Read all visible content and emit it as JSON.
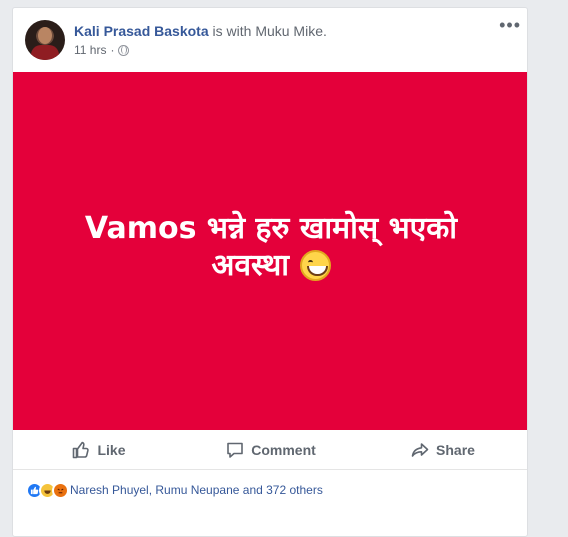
{
  "post": {
    "author": "Kali Prasad Baskota",
    "with_prefix": "is with",
    "with_name": "Muku Mike.",
    "time": "11 hrs",
    "meta_separator": "·",
    "more_label": "•••",
    "text_line1": "Vamos भन्ने हरु खामोस् भएको",
    "text_line2": "अवस्था",
    "background_color": "#e4003a"
  },
  "actions": {
    "like": "Like",
    "comment": "Comment",
    "share": "Share"
  },
  "reactions": {
    "summary": "Naresh Phuyel, Rumu Neupane and 372 others",
    "icons": [
      "like-icon",
      "haha-icon",
      "angry-icon"
    ]
  },
  "colors": {
    "link": "#365899",
    "text_secondary": "#616770",
    "page_bg": "#e9ebee"
  }
}
